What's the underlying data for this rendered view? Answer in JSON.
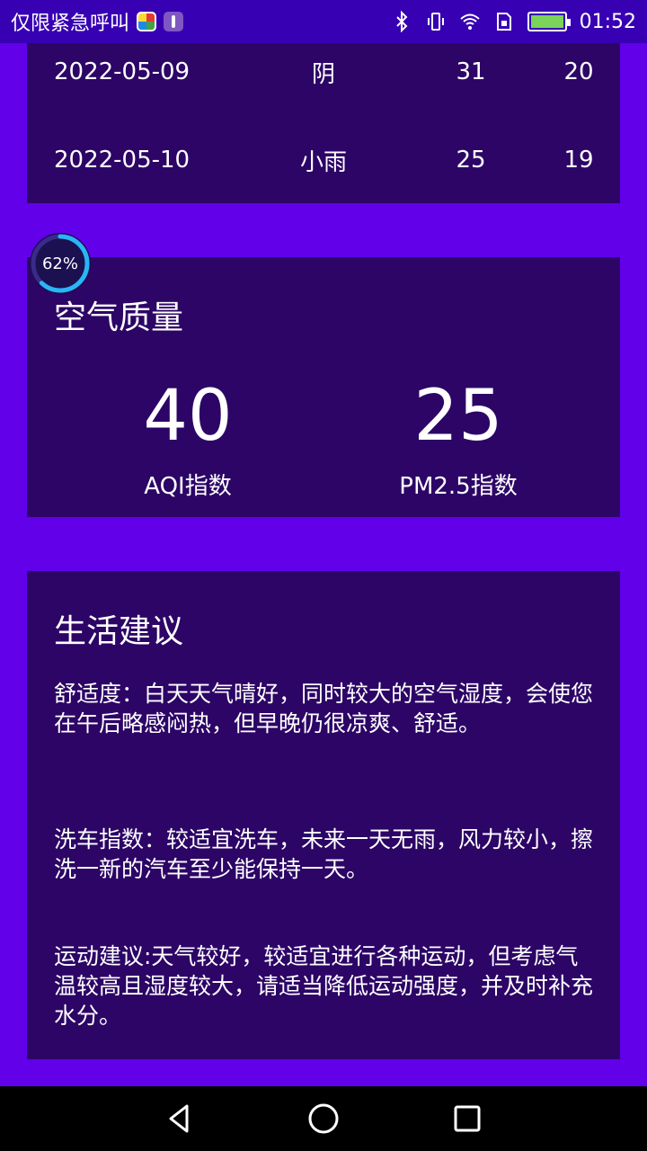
{
  "status_bar": {
    "carrier_text": "仅限紧急呼叫",
    "time": "01:52",
    "icons": [
      "colorful-app-icon",
      "usb-icon",
      "bluetooth-icon",
      "vibrate-icon",
      "wifi-icon",
      "sim-icon",
      "battery-icon"
    ]
  },
  "forecast": {
    "rows": [
      {
        "date": "2022-05-09",
        "weather": "阴",
        "max": "31",
        "min": "20"
      },
      {
        "date": "2022-05-10",
        "weather": "小雨",
        "max": "25",
        "min": "19"
      }
    ]
  },
  "progress_badge": {
    "text": "62%",
    "value": 0.62
  },
  "air_quality": {
    "title": "空气质量",
    "aqi_value": "40",
    "aqi_label": "AQI指数",
    "pm25_value": "25",
    "pm25_label": "PM2.5指数"
  },
  "life_advice": {
    "title": "生活建议",
    "comfort": "舒适度：白天天气晴好，同时较大的空气湿度，会使您在午后略感闷热，但早晚仍很凉爽、舒适。",
    "car_wash": "洗车指数：较适宜洗车，未来一天无雨，风力较小，擦洗一新的汽车至少能保持一天。",
    "sport": "运动建议:天气较好，较适宜进行各种运动，但考虑气温较高且湿度较大，请适当降低运动强度，并及时补充水分。"
  },
  "nav_bar": {
    "icons": [
      "back-icon",
      "home-icon",
      "recents-icon"
    ]
  },
  "colors": {
    "background": "#6200ea",
    "card": "#2c0566",
    "status_bar": "#3700b3"
  }
}
